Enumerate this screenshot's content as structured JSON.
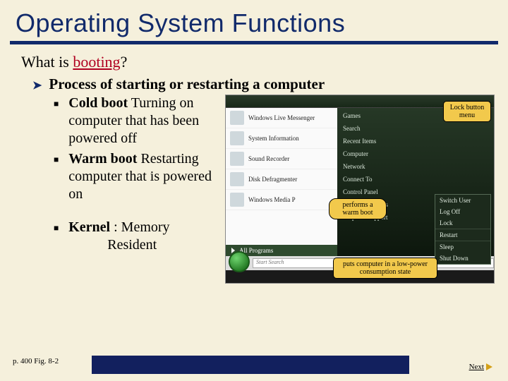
{
  "title": "Operating System Functions",
  "question_prefix": "What is ",
  "question_emphasis": "booting",
  "question_suffix": "?",
  "main_bullet": "Process of starting or restarting a computer",
  "subs": {
    "s1_bold": "Cold boot",
    "s1_rest": "  Turning on computer that has been powered off",
    "s2_bold": "Warm boot",
    "s2_rest": "  Restarting computer that is powered on",
    "s3_bold": "Kernel",
    "s3_rest": " : Memory",
    "s3_line2": "Resident"
  },
  "figure": {
    "left_items": [
      "Windows Live Messenger",
      "System Information",
      "Sound Recorder",
      "Disk Defragmenter",
      "Windows Media P"
    ],
    "all_programs": "All Programs",
    "search_placeholder": "Start Search",
    "right_items": [
      "Games",
      "Search",
      "Recent Items",
      "Computer",
      "Network",
      "Connect To",
      "Control Panel",
      "Default Programs",
      "Help and Support"
    ],
    "power_menu": [
      "Switch User",
      "Log Off",
      "Lock",
      "Restart",
      "Sleep",
      "Shut Down"
    ],
    "callouts": {
      "lock": "Lock button menu",
      "warm": "performs a warm boot",
      "lowpower": "puts computer in a low-power consumption state"
    }
  },
  "footer": {
    "pageref": "p. 400 Fig. 8-2",
    "next": "Next"
  }
}
